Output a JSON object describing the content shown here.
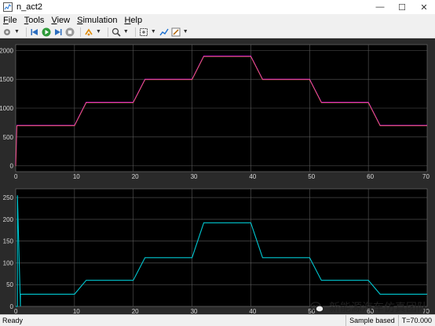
{
  "window": {
    "title": "n_act2",
    "minimize": "—",
    "maximize": "☐",
    "close": "✕"
  },
  "menu": [
    {
      "label": "File",
      "accel": "F",
      "rest": "ile"
    },
    {
      "label": "Tools",
      "accel": "T",
      "rest": "ools"
    },
    {
      "label": "View",
      "accel": "V",
      "rest": "iew"
    },
    {
      "label": "Simulation",
      "accel": "S",
      "rest": "imulation"
    },
    {
      "label": "Help",
      "accel": "H",
      "rest": "elp"
    }
  ],
  "toolbar_icons": [
    "settings-icon",
    "step-back-icon",
    "run-icon",
    "step-forward-icon",
    "stop-icon",
    "highlight-icon",
    "zoom-icon",
    "autoscale-icon",
    "cursor-measure-icon",
    "triggers-icon",
    "style-icon"
  ],
  "colors": {
    "plot_bg": "#000000",
    "figure_bg": "#2a2a2a",
    "grid": "#5a5a5a",
    "series_top_main": "#e61ee6",
    "series_top_secondary": "#f0a000",
    "series_bottom": "#00c8d2"
  },
  "chart_data": [
    {
      "type": "line",
      "xlim": [
        0,
        70
      ],
      "ylim": [
        -100,
        2100
      ],
      "xticks": [
        "0",
        "10",
        "20",
        "30",
        "40",
        "50",
        "60",
        "70"
      ],
      "yticks": [
        "0",
        "500",
        "1000",
        "1500",
        "2000"
      ],
      "grid": true,
      "series": [
        {
          "x": [
            0,
            0.2,
            0.4,
            10,
            12,
            20,
            22,
            30,
            32,
            40,
            42,
            50,
            52,
            60,
            62,
            70
          ],
          "y": [
            0,
            700,
            700,
            700,
            1100,
            1100,
            1500,
            1500,
            1900,
            1900,
            1500,
            1500,
            1100,
            1100,
            700,
            700
          ]
        }
      ]
    },
    {
      "type": "line",
      "xlim": [
        0,
        70
      ],
      "ylim": [
        0,
        270
      ],
      "xticks": [
        "0",
        "10",
        "20",
        "30",
        "40",
        "50",
        "60",
        "70"
      ],
      "yticks": [
        "0",
        "50",
        "100",
        "150",
        "200",
        "250"
      ],
      "grid": true,
      "series": [
        {
          "x": [
            0,
            0.3,
            0.3,
            0.8,
            0.8,
            10,
            12,
            20,
            22,
            30,
            32,
            40,
            42,
            50,
            52,
            60,
            62,
            70
          ],
          "y": [
            0,
            0,
            255,
            0,
            28,
            28,
            60,
            60,
            112,
            112,
            192,
            192,
            112,
            112,
            60,
            60,
            28,
            28
          ]
        }
      ]
    }
  ],
  "status": {
    "ready": "Ready",
    "sample": "Sample based",
    "time": "T=70.000"
  },
  "watermark": {
    "text": "新能源汽车仿真团队"
  }
}
